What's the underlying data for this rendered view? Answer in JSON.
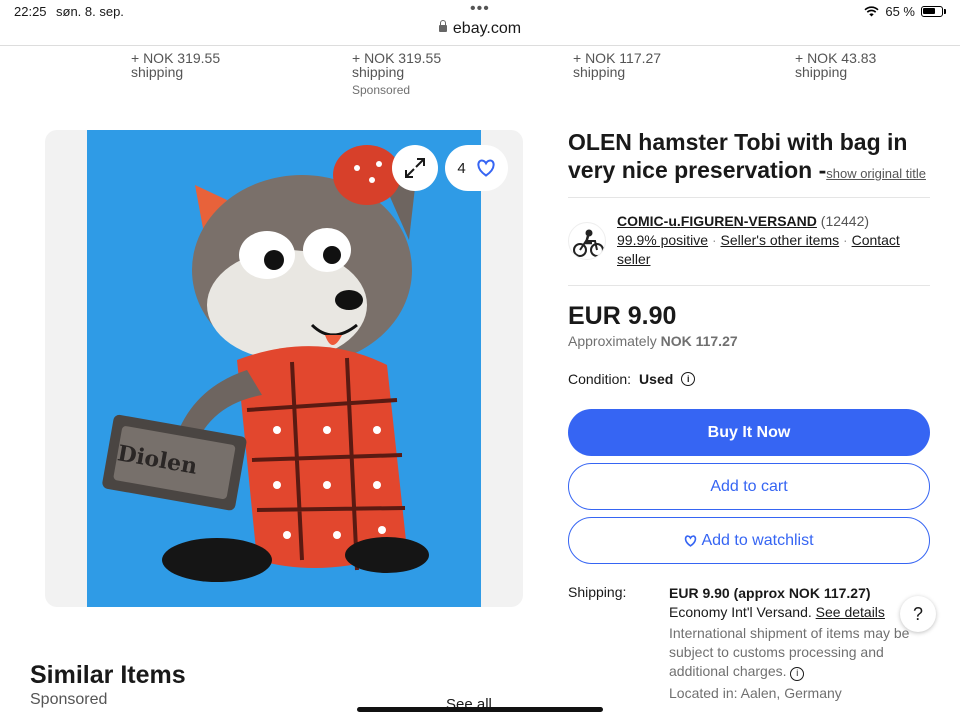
{
  "status_bar": {
    "time": "22:25",
    "date": "søn. 8. sep.",
    "battery": "65 %",
    "url": "ebay.com"
  },
  "carousel": [
    {
      "price": "+ NOK 319.55",
      "label": "shipping",
      "sponsored": ""
    },
    {
      "price": "+ NOK 319.55",
      "label": "shipping",
      "sponsored": "Sponsored"
    },
    {
      "price": "+ NOK 117.27",
      "label": "shipping",
      "sponsored": ""
    },
    {
      "price": "+ NOK 43.83",
      "label": "shipping",
      "sponsored": ""
    }
  ],
  "gallery": {
    "watch_count": "4",
    "bag_text": "Diolen"
  },
  "item": {
    "title": "OLEN hamster Tobi with bag in very nice preservation -",
    "show_original": "show original title"
  },
  "seller": {
    "name": "COMIC-u.FIGUREN-VERSAND",
    "feedback_count": "(12442)",
    "positive": "99.9% positive",
    "other_items": "Seller's other items",
    "contact": "Contact seller"
  },
  "pricing": {
    "price": "EUR 9.90",
    "approx_prefix": "Approximately",
    "approx_value": "NOK 117.27"
  },
  "condition": {
    "label": "Condition:",
    "value": "Used"
  },
  "buttons": {
    "buy_now": "Buy It Now",
    "add_to_cart": "Add to cart",
    "add_to_watchlist": "Add to watchlist"
  },
  "shipping": {
    "label": "Shipping:",
    "cost": "EUR 9.90 (approx NOK 117.27)",
    "service": "Economy Int'l Versand.",
    "see_details": "See details",
    "customs_note": "International shipment of items may be subject to customs processing and additional charges.",
    "located": "Located in: Aalen, Germany"
  },
  "similar": {
    "title": "Similar Items",
    "sponsored": "Sponsored",
    "see_all": "See all"
  },
  "help": "?",
  "colors": {
    "primary": "#3665f3",
    "photo_bg": "#2f9be6"
  }
}
